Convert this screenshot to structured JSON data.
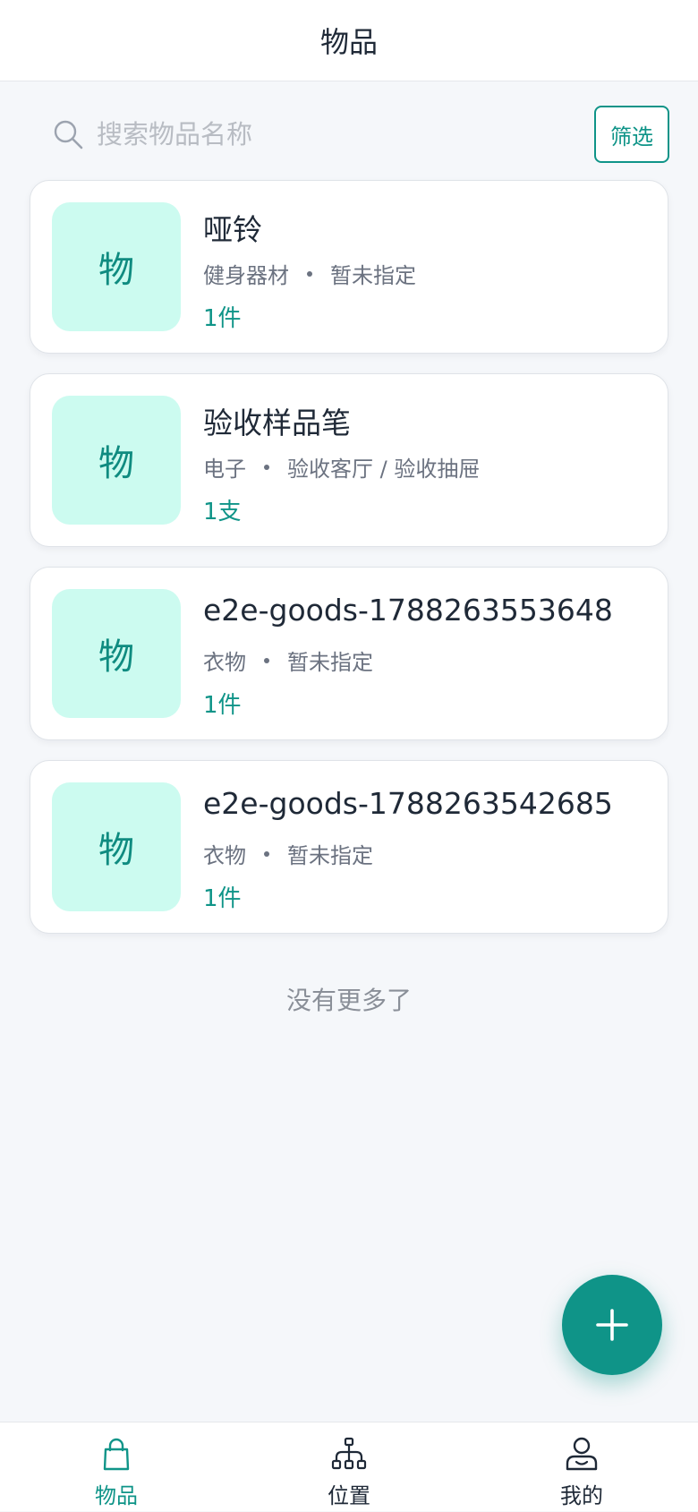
{
  "header": {
    "title": "物品"
  },
  "search": {
    "placeholder": "搜索物品名称",
    "value": "",
    "filter_label": "筛选"
  },
  "items": [
    {
      "thumb": "物",
      "name": "哑铃",
      "category": "健身器材",
      "location": "暂未指定",
      "quantity": "1件"
    },
    {
      "thumb": "物",
      "name": "验收样品笔",
      "category": "电子",
      "location": "验收客厅 / 验收抽屉",
      "quantity": "1支"
    },
    {
      "thumb": "物",
      "name": "e2e-goods-1788263553648",
      "category": "衣物",
      "location": "暂未指定",
      "quantity": "1件"
    },
    {
      "thumb": "物",
      "name": "e2e-goods-1788263542685",
      "category": "衣物",
      "location": "暂未指定",
      "quantity": "1件"
    }
  ],
  "list_footer": "没有更多了",
  "fab": {
    "icon": "plus-icon"
  },
  "tabbar": {
    "tabs": [
      {
        "label": "物品",
        "icon": "shopping-bag-icon",
        "active": true
      },
      {
        "label": "位置",
        "icon": "hierarchy-icon",
        "active": false
      },
      {
        "label": "我的",
        "icon": "user-icon",
        "active": false
      }
    ]
  },
  "colors": {
    "accent": "#0f9488",
    "thumb_bg": "#ccfbf0",
    "page_bg": "#f5f7fa",
    "text_primary": "#1f2937",
    "text_secondary": "#6b7280"
  }
}
